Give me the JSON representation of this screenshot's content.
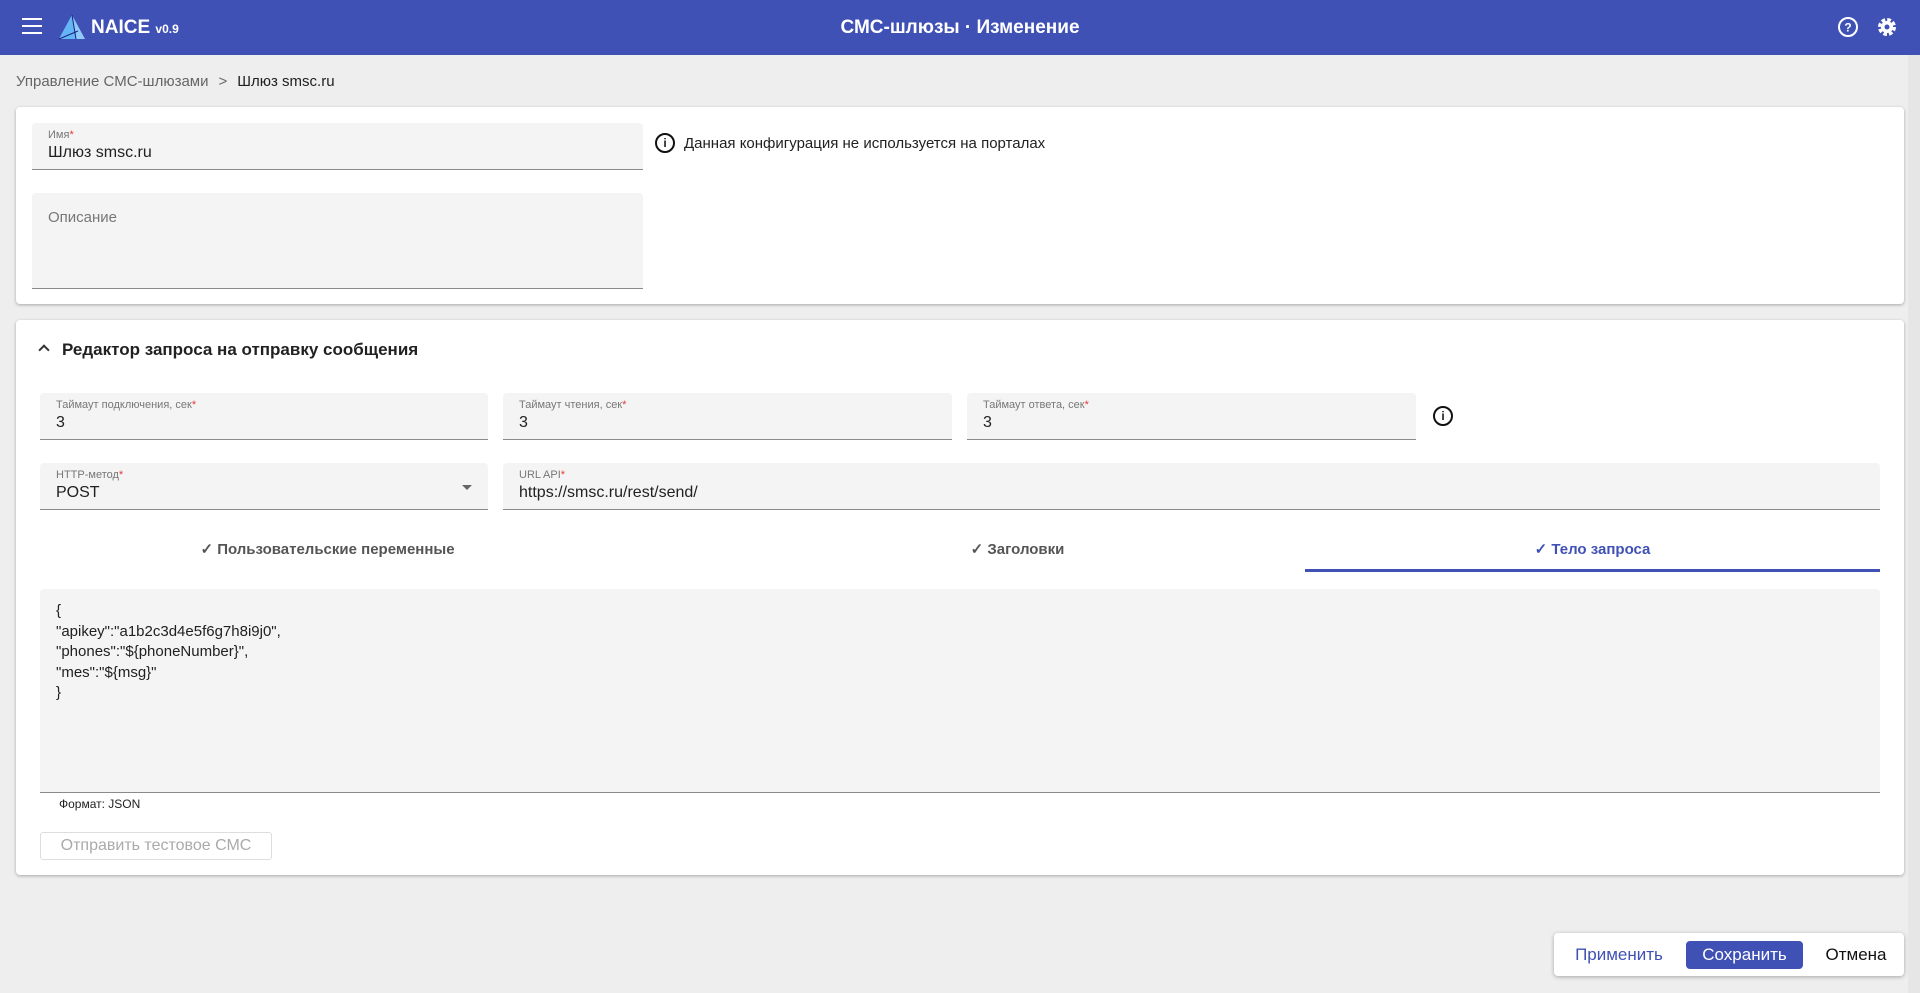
{
  "app": {
    "brand": "NAICE",
    "version": "v0.9",
    "title": "СМС-шлюзы · Изменение"
  },
  "breadcrumb": {
    "parent": "Управление СМС-шлюзами",
    "separator": ">",
    "current": "Шлюз smsc.ru"
  },
  "general": {
    "name_label": "Имя",
    "name_value": "Шлюз smsc.ru",
    "description_placeholder": "Описание",
    "info_text": "Данная конфигурация не используется на порталах"
  },
  "editor": {
    "section_title": "Редактор запроса на отправку сообщения",
    "connect_timeout": {
      "label": "Таймаут подключения, сек",
      "value": "3"
    },
    "read_timeout": {
      "label": "Таймаут чтения, сек",
      "value": "3"
    },
    "response_timeout": {
      "label": "Таймаут ответа, сек",
      "value": "3"
    },
    "http_method": {
      "label": "HTTP-метод",
      "value": "POST"
    },
    "url": {
      "label": "URL API",
      "value": "https://smsc.ru/rest/send/"
    },
    "tabs": [
      {
        "label": "Пользовательские переменные"
      },
      {
        "label": "Заголовки"
      },
      {
        "label": "Тело запроса",
        "active": true
      }
    ],
    "body": "{\n\"apikey\":\"a1b2c3d4e5f6g7h8i9j0\",\n\"phones\":\"${phoneNumber}\",\n\"mes\":\"${msg}\"\n}",
    "format": "Формат: JSON",
    "test_button": "Отправить тестовое СМС"
  },
  "actions": {
    "apply": "Применить",
    "save": "Сохранить",
    "cancel": "Отмена"
  },
  "colors": {
    "primary": "#3f51b5",
    "required": "#e53935"
  }
}
